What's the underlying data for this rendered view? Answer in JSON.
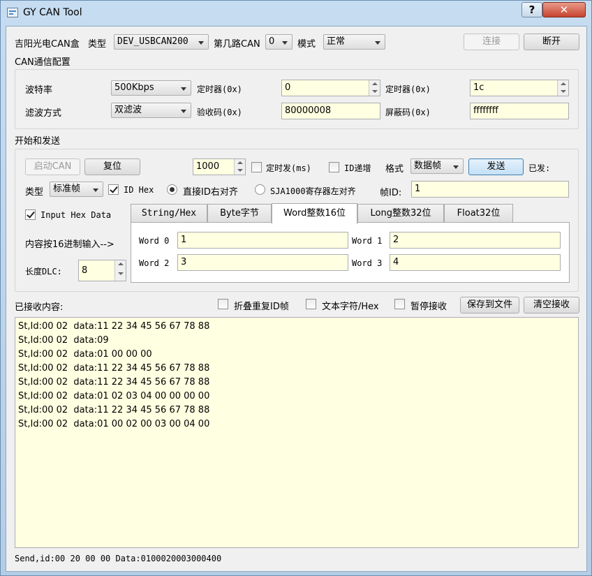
{
  "window": {
    "title": "GY CAN Tool",
    "help_glyph": "?",
    "close_glyph": "✕"
  },
  "top": {
    "brand_label": "吉阳光电CAN盒",
    "type_label": "类型",
    "device": "DEV_USBCAN200",
    "channel_label": "第几路CAN",
    "channel": "0",
    "mode_label": "模式",
    "mode": "正常",
    "connect": "连接",
    "disconnect": "断开"
  },
  "config": {
    "title": "CAN通信配置",
    "baud_label": "波特率",
    "baud": "500Kbps",
    "timer0_label": "定时器(0x)",
    "timer0": "0",
    "timer1_label": "定时器(0x)",
    "timer1": "1c",
    "filter_label": "滤波方式",
    "filter": "双滤波",
    "acc_code_label": "验收码(0x)",
    "acc_code": "80000008",
    "mask_label": "屏蔽码(0x)",
    "mask": "ffffffff"
  },
  "send": {
    "title": "开始和发送",
    "start": "启动CAN",
    "reset": "复位",
    "interval": "1000",
    "timed_send": "定时发(ms)",
    "id_increment": "ID递增",
    "format_label": "格式",
    "format": "数据帧",
    "send_button": "发送",
    "sent_label": "已发:",
    "type_label": "类型",
    "frame_type": "标准帧",
    "id_hex": "ID Hex",
    "align_right": "直接ID右对齐",
    "align_left": "SJA1000寄存器左对齐",
    "frame_id_label": "帧ID:",
    "frame_id": "1",
    "input_hex": "Input Hex Data",
    "hex_hint": "内容按16进制输入-->",
    "dlc_label": "长度DLC:",
    "dlc": "8",
    "tabs": [
      "String/Hex",
      "Byte字节",
      "Word整数16位",
      "Long整数32位",
      "Float32位"
    ],
    "words": [
      {
        "label": "Word 0",
        "value": "1"
      },
      {
        "label": "Word 1",
        "value": "2"
      },
      {
        "label": "Word 2",
        "value": "3"
      },
      {
        "label": "Word 3",
        "value": "4"
      }
    ]
  },
  "receive": {
    "title": "已接收内容:",
    "fold_dup": "折叠重复ID帧",
    "text_hex": "文本字符/Hex",
    "pause": "暂停接收",
    "save": "保存到文件",
    "clear": "清空接收",
    "lines": [
      "St,Id:00 02  data:11 22 34 45 56 67 78 88",
      "St,Id:00 02  data:09",
      "St,Id:00 02  data:01 00 00 00",
      "St,Id:00 02  data:11 22 34 45 56 67 78 88",
      "St,Id:00 02  data:11 22 34 45 56 67 78 88",
      "St,Id:00 02  data:01 02 03 04 00 00 00 00",
      "St,Id:00 02  data:11 22 34 45 56 67 78 88",
      "St,Id:00 02  data:01 00 02 00 03 00 04 00"
    ]
  },
  "status": "Send,id:00 20 00 00 Data:0100020003000400"
}
